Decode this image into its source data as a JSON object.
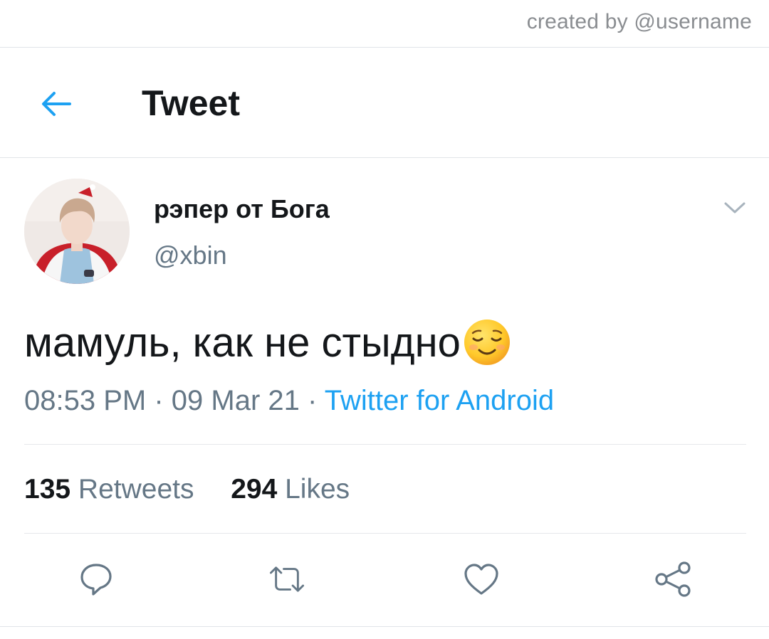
{
  "watermark": "created by @username",
  "header": {
    "title": "Tweet",
    "back_icon": "arrow-left-icon"
  },
  "tweet": {
    "display_name": "рэпер от Бога",
    "handle": "@xbin",
    "text": "мамуль, как не стыдно",
    "emoji_icon": "relieved-face-emoji",
    "time": "08:53 PM",
    "separator": "·",
    "date": "09 Mar 21",
    "source": "Twitter for Android"
  },
  "stats": {
    "retweets_count": "135",
    "retweets_label": "Retweets",
    "likes_count": "294",
    "likes_label": "Likes"
  },
  "actions": [
    "reply-icon",
    "retweet-icon",
    "like-icon",
    "share-icon"
  ],
  "colors": {
    "accent": "#1da1f2",
    "text_primary": "#14171a",
    "text_secondary": "#657786",
    "divider": "#e1e4e8"
  }
}
